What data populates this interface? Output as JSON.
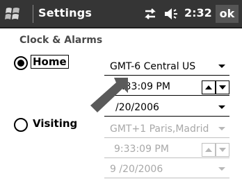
{
  "titlebar": {
    "app_title": "Settings",
    "time": "2:32",
    "ok_label": "ok",
    "icons": [
      "windows-start-icon",
      "connectivity-icon",
      "volume-icon"
    ]
  },
  "page": {
    "section_title": "Clock & Alarms"
  },
  "home": {
    "label": "Home",
    "selected": true,
    "timezone": "GMT-6 Central US",
    "time": "2:33:09 PM",
    "date": "/20/2006"
  },
  "visiting": {
    "label": "Visiting",
    "selected": false,
    "timezone": "GMT+1 Paris,Madrid",
    "time": "9:33:09 PM",
    "date": "9 /20/2006"
  },
  "colors": {
    "titlebar_bg": "#353535",
    "disabled_text": "#a8a8a8",
    "overlay_arrow": "#5a5a5a"
  }
}
